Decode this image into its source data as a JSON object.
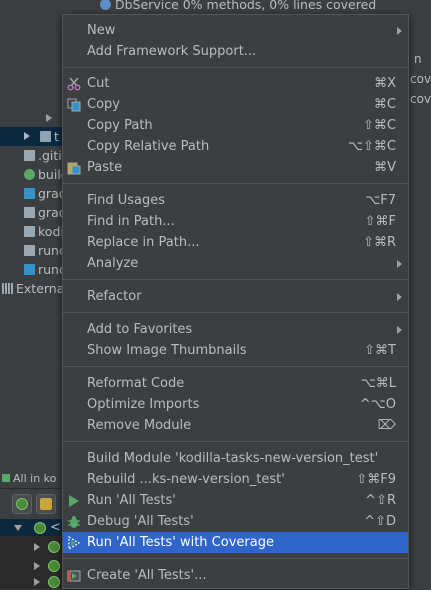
{
  "background": {
    "coverage_line": "DbService  0% methods, 0% lines covered",
    "right_snippets": [
      "n",
      "cove",
      "cove"
    ],
    "tree_items": [
      {
        "label": "t",
        "icon": "folder-icon"
      },
      {
        "label": ".gitig",
        "icon": "file-icon"
      },
      {
        "label": "build",
        "icon": "gradle-icon"
      },
      {
        "label": "grad",
        "icon": "script-icon"
      },
      {
        "label": "grad",
        "icon": "bat-icon"
      },
      {
        "label": "kodil",
        "icon": "file-icon"
      },
      {
        "label": "runc",
        "icon": "bat-icon"
      },
      {
        "label": "runc",
        "icon": "script-icon"
      },
      {
        "label": "Externa",
        "icon": "library-icon"
      }
    ],
    "panel_header": "All in ko",
    "test_tree_root": "<<"
  },
  "menu": {
    "items": [
      {
        "label": "New",
        "shortcut": "",
        "submenu": true,
        "icon": ""
      },
      {
        "label": "Add Framework Support...",
        "shortcut": "",
        "submenu": false,
        "icon": ""
      },
      {
        "label": "Cut",
        "shortcut": "⌘X",
        "submenu": false,
        "icon": "scissors-icon"
      },
      {
        "label": "Copy",
        "shortcut": "⌘C",
        "submenu": false,
        "icon": "copy-icon"
      },
      {
        "label": "Copy Path",
        "shortcut": "⇧⌘C",
        "submenu": false,
        "icon": ""
      },
      {
        "label": "Copy Relative Path",
        "shortcut": "⌥⇧⌘C",
        "submenu": false,
        "icon": ""
      },
      {
        "label": "Paste",
        "shortcut": "⌘V",
        "submenu": false,
        "icon": "paste-icon"
      },
      {
        "label": "Find Usages",
        "shortcut": "⌥F7",
        "submenu": false,
        "icon": ""
      },
      {
        "label": "Find in Path...",
        "shortcut": "⇧⌘F",
        "submenu": false,
        "icon": ""
      },
      {
        "label": "Replace in Path...",
        "shortcut": "⇧⌘R",
        "submenu": false,
        "icon": ""
      },
      {
        "label": "Analyze",
        "shortcut": "",
        "submenu": true,
        "icon": ""
      },
      {
        "label": "Refactor",
        "shortcut": "",
        "submenu": true,
        "icon": ""
      },
      {
        "label": "Add to Favorites",
        "shortcut": "",
        "submenu": true,
        "icon": ""
      },
      {
        "label": "Show Image Thumbnails",
        "shortcut": "⇧⌘T",
        "submenu": false,
        "icon": ""
      },
      {
        "label": "Reformat Code",
        "shortcut": "⌥⌘L",
        "submenu": false,
        "icon": ""
      },
      {
        "label": "Optimize Imports",
        "shortcut": "^⌥O",
        "submenu": false,
        "icon": ""
      },
      {
        "label": "Remove Module",
        "shortcut": "⌦",
        "submenu": false,
        "icon": ""
      },
      {
        "label": "Build Module 'kodilla-tasks-new-version_test'",
        "shortcut": "",
        "submenu": false,
        "icon": ""
      },
      {
        "label": "Rebuild ...ks-new-version_test'",
        "shortcut": "⇧⌘F9",
        "submenu": false,
        "icon": ""
      },
      {
        "label": "Run 'All Tests'",
        "shortcut": "^⇧R",
        "submenu": false,
        "icon": "run-icon"
      },
      {
        "label": "Debug 'All Tests'",
        "shortcut": "^⇧D",
        "submenu": false,
        "icon": "debug-icon"
      },
      {
        "label": "Run 'All Tests' with Coverage",
        "shortcut": "",
        "submenu": false,
        "icon": "coverage-icon",
        "highlighted": true
      },
      {
        "label": "Create 'All Tests'...",
        "shortcut": "",
        "submenu": false,
        "icon": "create-config-icon"
      }
    ]
  },
  "colors": {
    "menu_bg": "#3c3f41",
    "highlight": "#2f65ca",
    "run_green": "#59a869",
    "separator": "#515658"
  }
}
